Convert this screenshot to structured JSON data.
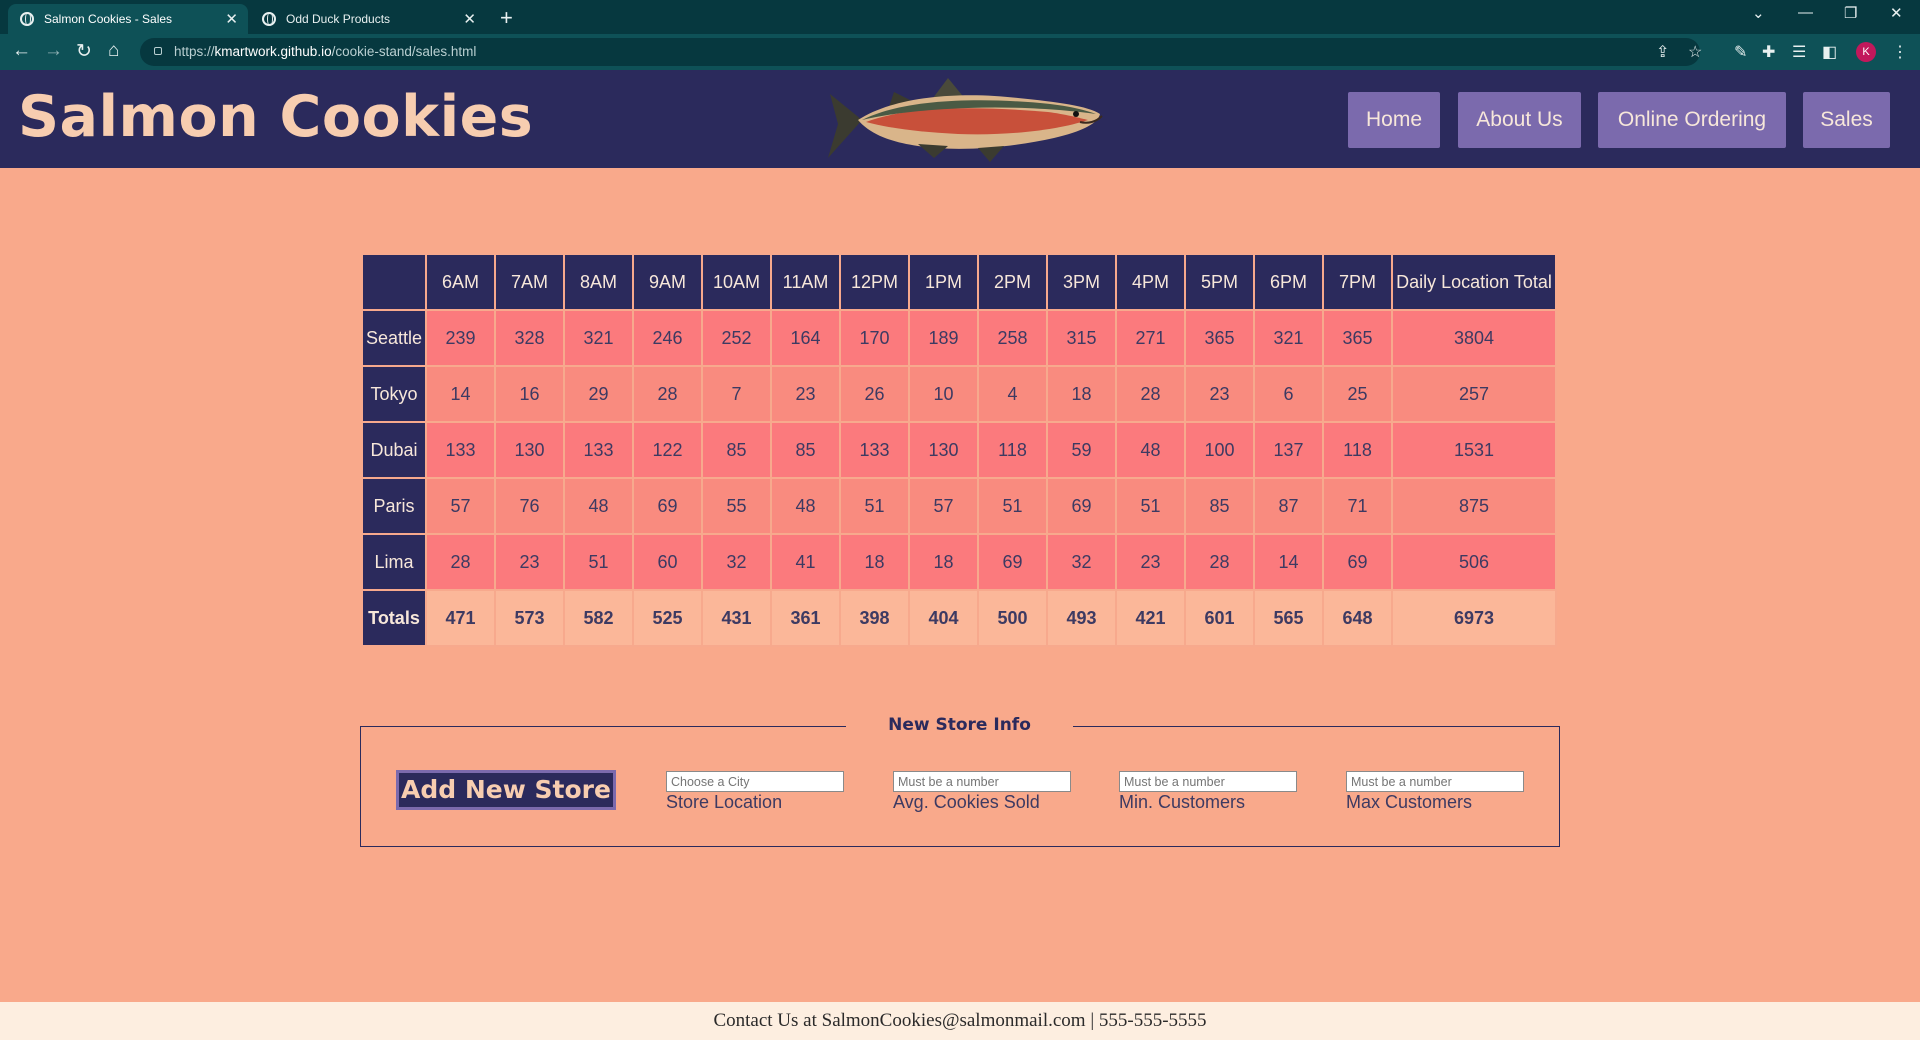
{
  "browser": {
    "tabs": [
      {
        "label": "Salmon Cookies - Sales",
        "active": true
      },
      {
        "label": "Odd Duck Products",
        "active": false
      }
    ],
    "url_prefix": "https://",
    "url_host": "kmartwork.github.io",
    "url_path": "/cookie-stand/sales.html"
  },
  "header": {
    "logo": "Salmon Cookies",
    "nav": [
      "Home",
      "About Us",
      "Online Ordering",
      "Sales"
    ]
  },
  "table": {
    "corner": "",
    "hours": [
      "6AM",
      "7AM",
      "8AM",
      "9AM",
      "10AM",
      "11AM",
      "12PM",
      "1PM",
      "2PM",
      "3PM",
      "4PM",
      "5PM",
      "6PM",
      "7PM"
    ],
    "total_header": "Daily Location Total",
    "rows": [
      {
        "city": "Seattle",
        "values": [
          239,
          328,
          321,
          246,
          252,
          164,
          170,
          189,
          258,
          315,
          271,
          365,
          321,
          365
        ],
        "total": 3804
      },
      {
        "city": "Tokyo",
        "values": [
          14,
          16,
          29,
          28,
          7,
          23,
          26,
          10,
          4,
          18,
          28,
          23,
          6,
          25
        ],
        "total": 257
      },
      {
        "city": "Dubai",
        "values": [
          133,
          130,
          133,
          122,
          85,
          85,
          133,
          130,
          118,
          59,
          48,
          100,
          137,
          118
        ],
        "total": 1531
      },
      {
        "city": "Paris",
        "values": [
          57,
          76,
          48,
          69,
          55,
          48,
          51,
          57,
          51,
          69,
          51,
          85,
          87,
          71
        ],
        "total": 875
      },
      {
        "city": "Lima",
        "values": [
          28,
          23,
          51,
          60,
          32,
          41,
          18,
          18,
          69,
          32,
          23,
          28,
          14,
          69
        ],
        "total": 506
      }
    ],
    "totals_label": "Totals",
    "totals": [
      471,
      573,
      582,
      525,
      431,
      361,
      398,
      404,
      500,
      493,
      421,
      601,
      565,
      648
    ],
    "grand_total": 6973
  },
  "form": {
    "legend": "New Store Info",
    "submit_label": "Add New Store",
    "fields": [
      {
        "placeholder": "Choose a City",
        "label": "Store Location"
      },
      {
        "placeholder": "Must be a number",
        "label": "Avg. Cookies Sold"
      },
      {
        "placeholder": "Must be a number",
        "label": "Min. Customers"
      },
      {
        "placeholder": "Must be a number",
        "label": "Max Customers"
      }
    ]
  },
  "footer": {
    "text": "Contact Us at SalmonCookies@salmonmail.com | 555-555-5555"
  },
  "profile_initial": "K",
  "colors": {
    "navy": "#2b2a5c",
    "salmon_bg": "#f9a98b",
    "nav_button": "#7b6aad",
    "row_odd": "#fb7a7d",
    "row_even": "#f98b7f",
    "totals_row": "#fbb799",
    "logo_text": "#f7cdb0"
  }
}
